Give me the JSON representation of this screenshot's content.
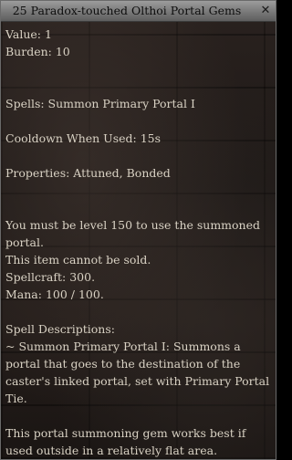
{
  "window": {
    "title": "25 Paradox-touched Olthoi Portal Gems",
    "close_icon": "x-close-icon"
  },
  "details": {
    "value": "Value: 1",
    "burden": "Burden: 10",
    "spells": "Spells: Summon Primary Portal I",
    "cooldown": "Cooldown When Used: 15s",
    "properties": "Properties: Attuned, Bonded",
    "requirement_line1": "You must be level 150 to use the summoned",
    "requirement_line2": "portal.",
    "cannot_sell": "This item cannot be sold.",
    "spellcraft": "Spellcraft: 300.",
    "mana": "Mana: 100 / 100.",
    "spell_descriptions_header": "Spell Descriptions:",
    "spell_desc_line1": "~ Summon Primary Portal I: Summons a",
    "spell_desc_line2": "portal that goes to the destination of the",
    "spell_desc_line3": "caster's linked portal, set with Primary Portal",
    "spell_desc_line4": "Tie.",
    "usage_line1": "This portal summoning gem works best if",
    "usage_line2": "used outside in a relatively flat area."
  }
}
